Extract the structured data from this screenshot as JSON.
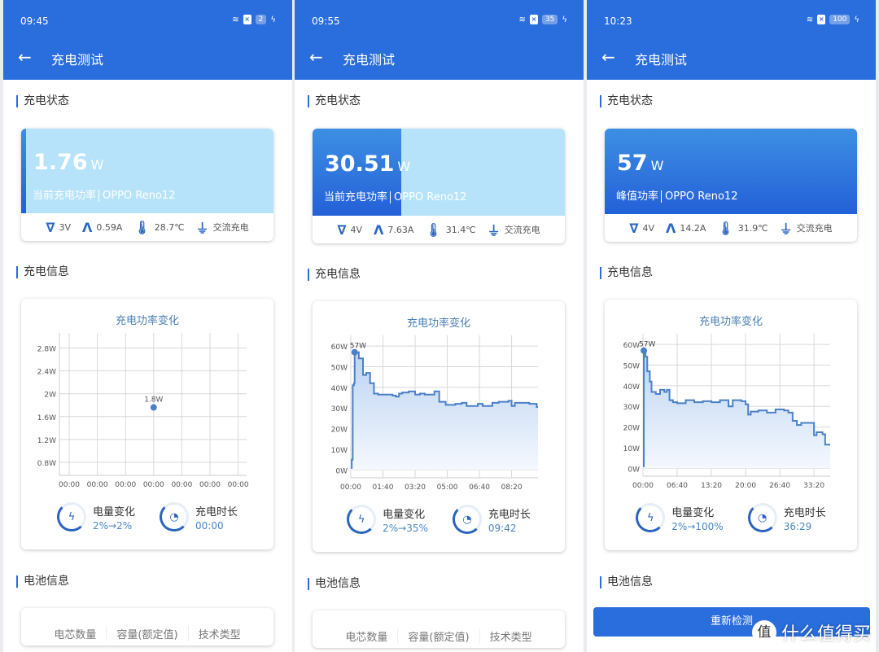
{
  "colors": {
    "accent": "#2a6ddd",
    "line": "#4a80c8",
    "hero_unfilled": "#b6e3fa"
  },
  "watermark": {
    "logo_char": "值",
    "text": "什么值得买"
  },
  "panels": [
    {
      "status": {
        "time": "09:45",
        "battery": "2"
      },
      "app_title": "充电测试",
      "back_icon": "arrow-left-icon",
      "section_status": "充电状态",
      "section_info": "充电信息",
      "section_battery": "电池信息",
      "hero": {
        "power": "1.76",
        "unit": "W",
        "label": "当前充电功率",
        "device": "OPPO Reno12",
        "battery_fill_percent": 2
      },
      "metrics": {
        "voltage": "3V",
        "current": "0.59A",
        "temperature": "28.7℃",
        "type": "交流充电"
      },
      "chart_title": "充电功率变化",
      "stats": {
        "capacity_label": "电量变化",
        "capacity_value": "2%→2%",
        "duration_label": "充电时长",
        "duration_value": "00:00"
      },
      "battery_table": [
        "电芯数量",
        "容量(额定值)",
        "技术类型"
      ]
    },
    {
      "status": {
        "time": "09:55",
        "battery": "35"
      },
      "app_title": "充电测试",
      "back_icon": "arrow-left-icon",
      "section_status": "充电状态",
      "section_info": "充电信息",
      "section_battery": "电池信息",
      "hero": {
        "power": "30.51",
        "unit": "W",
        "label": "当前充电功率",
        "device": "OPPO Reno12",
        "battery_fill_percent": 35
      },
      "metrics": {
        "voltage": "4V",
        "current": "7.63A",
        "temperature": "31.4℃",
        "type": "交流充电"
      },
      "chart_title": "充电功率变化",
      "stats": {
        "capacity_label": "电量变化",
        "capacity_value": "2%→35%",
        "duration_label": "充电时长",
        "duration_value": "09:42"
      },
      "battery_table": [
        "电芯数量",
        "容量(额定值)",
        "技术类型"
      ]
    },
    {
      "status": {
        "time": "10:23",
        "battery": "100"
      },
      "app_title": "充电测试",
      "back_icon": "arrow-left-icon",
      "section_status": "充电状态",
      "section_info": "充电信息",
      "section_battery": "电池信息",
      "hero": {
        "power": "57",
        "unit": "W",
        "label": "峰值功率",
        "device": "OPPO Reno12",
        "battery_fill_percent": 100
      },
      "metrics": {
        "voltage": "4V",
        "current": "14.2A",
        "temperature": "31.9℃",
        "type": "交流充电"
      },
      "chart_title": "充电功率变化",
      "stats": {
        "capacity_label": "电量变化",
        "capacity_value": "2%→100%",
        "duration_label": "充电时长",
        "duration_value": "36:29"
      },
      "retest_button": "重新检测"
    }
  ],
  "chart_data": [
    {
      "type": "scatter",
      "title": "充电功率变化",
      "ylim": [
        0.6,
        2.95
      ],
      "yticks": [
        "0.8W",
        "1.2W",
        "1.6W",
        "2W",
        "2.4W",
        "2.8W"
      ],
      "ytick_values": [
        0.8,
        1.2,
        1.6,
        2,
        2.4,
        2.8
      ],
      "xticks": [
        "00:00",
        "00:00",
        "00:00",
        "00:00",
        "00:00",
        "00:00",
        "00:00"
      ],
      "points": [
        {
          "x": 3,
          "y": 1.76
        }
      ],
      "annotation": "1.8W",
      "grid": true
    },
    {
      "type": "area",
      "title": "充电功率变化",
      "ylim": [
        -3,
        62
      ],
      "xlim": [
        "00:00",
        "09:42"
      ],
      "grid": true,
      "yticks": [
        "0W",
        "10W",
        "20W",
        "30W",
        "40W",
        "50W",
        "60W"
      ],
      "ytick_values": [
        0,
        10,
        20,
        30,
        40,
        50,
        60
      ],
      "xticks": [
        "00:00",
        "01:40",
        "03:20",
        "05:00",
        "06:40",
        "08:20"
      ],
      "annotation": "57W",
      "peak": {
        "x": "00:12",
        "y": 57
      },
      "points": [
        [
          "00:00",
          1
        ],
        [
          "00:03",
          5
        ],
        [
          "00:06",
          41
        ],
        [
          "00:10",
          42
        ],
        [
          "00:12",
          57
        ],
        [
          "00:25",
          54
        ],
        [
          "00:38",
          46
        ],
        [
          "00:48",
          47
        ],
        [
          "01:00",
          42
        ],
        [
          "01:12",
          37
        ],
        [
          "01:25",
          36.5
        ],
        [
          "02:10",
          36
        ],
        [
          "02:20",
          35.5
        ],
        [
          "02:30",
          37
        ],
        [
          "02:40",
          37.5
        ],
        [
          "03:00",
          38
        ],
        [
          "03:20",
          36.5
        ],
        [
          "03:35",
          37
        ],
        [
          "03:50",
          36.5
        ],
        [
          "04:20",
          38
        ],
        [
          "04:35",
          33
        ],
        [
          "04:55",
          31.5
        ],
        [
          "05:25",
          32
        ],
        [
          "05:45",
          32.5
        ],
        [
          "06:00",
          31
        ],
        [
          "06:35",
          32
        ],
        [
          "06:50",
          31
        ],
        [
          "07:20",
          32.5
        ],
        [
          "07:40",
          33
        ],
        [
          "08:10",
          33.5
        ],
        [
          "08:20",
          31
        ],
        [
          "08:30",
          32.5
        ],
        [
          "09:15",
          32
        ],
        [
          "09:38",
          30.5
        ],
        [
          "09:42",
          30.5
        ]
      ]
    },
    {
      "type": "area",
      "title": "充电功率变化",
      "ylim": [
        -3,
        62
      ],
      "xlim": [
        "00:00",
        "36:29"
      ],
      "grid": true,
      "yticks": [
        "0W",
        "10W",
        "20W",
        "30W",
        "40W",
        "50W",
        "60W"
      ],
      "ytick_values": [
        0,
        10,
        20,
        30,
        40,
        50,
        60
      ],
      "xticks": [
        "00:00",
        "06:40",
        "13:20",
        "20:00",
        "26:40",
        "33:20"
      ],
      "annotation": "57W",
      "peak": {
        "x": "00:10",
        "y": 57
      },
      "points": [
        [
          "00:00",
          1
        ],
        [
          "00:10",
          57
        ],
        [
          "00:30",
          54
        ],
        [
          "00:50",
          47
        ],
        [
          "01:20",
          42
        ],
        [
          "01:40",
          37
        ],
        [
          "02:30",
          36
        ],
        [
          "03:20",
          38
        ],
        [
          "04:10",
          37
        ],
        [
          "04:40",
          38
        ],
        [
          "05:10",
          33
        ],
        [
          "05:50",
          32
        ],
        [
          "06:40",
          31.5
        ],
        [
          "08:20",
          33
        ],
        [
          "10:00",
          32
        ],
        [
          "11:40",
          32.5
        ],
        [
          "13:20",
          32
        ],
        [
          "15:00",
          33
        ],
        [
          "16:40",
          30
        ],
        [
          "17:30",
          33
        ],
        [
          "19:10",
          32.5
        ],
        [
          "20:00",
          31
        ],
        [
          "20:30",
          26
        ],
        [
          "21:00",
          27.5
        ],
        [
          "22:30",
          28
        ],
        [
          "24:10",
          27
        ],
        [
          "25:50",
          28.5
        ],
        [
          "27:30",
          28
        ],
        [
          "28:20",
          27
        ],
        [
          "29:10",
          23
        ],
        [
          "30:00",
          21
        ],
        [
          "30:50",
          22
        ],
        [
          "32:30",
          22
        ],
        [
          "33:20",
          16
        ],
        [
          "33:50",
          17.5
        ],
        [
          "35:00",
          16.5
        ],
        [
          "35:30",
          11.5
        ],
        [
          "36:29",
          11.5
        ]
      ]
    }
  ]
}
